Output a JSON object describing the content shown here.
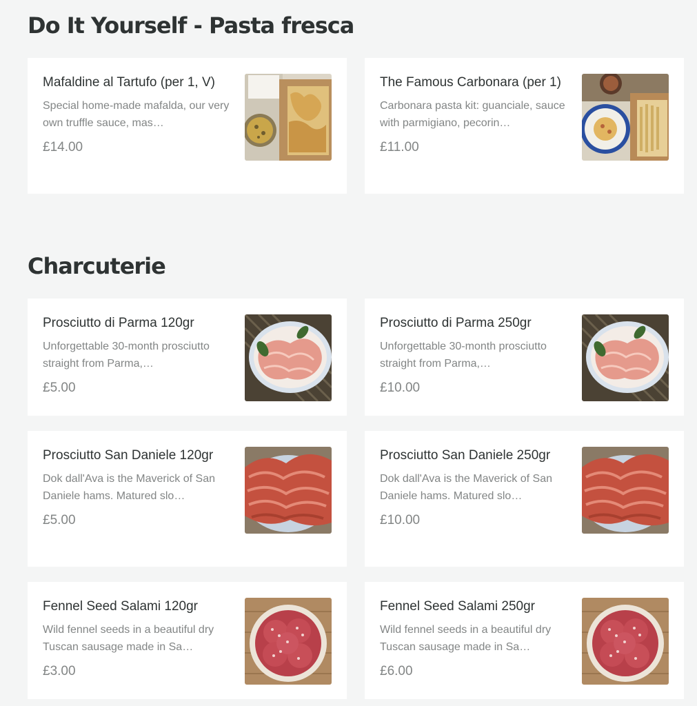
{
  "sections": [
    {
      "title": "Do It Yourself - Pasta fresca",
      "items": [
        {
          "name": "Mafaldine al Tartufo (per 1, V)",
          "description": "Special home-made mafalda, our very own truffle sauce, mas…",
          "price": "£14.00",
          "image": "pasta-kit-truffle-image"
        },
        {
          "name": "The Famous Carbonara (per 1)",
          "description": "Carbonara pasta kit: guanciale, sauce with parmigiano, pecorin…",
          "price": "£11.00",
          "image": "pasta-kit-carbonara-image"
        }
      ]
    },
    {
      "title": "Charcuterie",
      "items": [
        {
          "name": "Prosciutto di Parma 120gr",
          "description": "Unforgettable 30-month prosciutto straight from Parma,…",
          "price": "£5.00",
          "image": "prosciutto-plate-image"
        },
        {
          "name": "Prosciutto di Parma 250gr",
          "description": "Unforgettable 30-month prosciutto straight from Parma,…",
          "price": "£10.00",
          "image": "prosciutto-plate-image"
        },
        {
          "name": "Prosciutto San Daniele 120gr",
          "description": "Dok dall'Ava is the Maverick of San Daniele hams. Matured slo…",
          "price": "£5.00",
          "image": "san-daniele-ham-image"
        },
        {
          "name": "Prosciutto San Daniele 250gr",
          "description": "Dok dall'Ava is the Maverick of San Daniele hams. Matured slo…",
          "price": "£10.00",
          "image": "san-daniele-ham-image"
        },
        {
          "name": "Fennel Seed Salami 120gr",
          "description": "Wild fennel seeds in a beautiful dry Tuscan sausage made in Sa…",
          "price": "£3.00",
          "image": "salami-plate-image"
        },
        {
          "name": "Fennel Seed Salami 250gr",
          "description": "Wild fennel seeds in a beautiful dry Tuscan sausage made in Sa…",
          "price": "£6.00",
          "image": "salami-plate-image"
        }
      ]
    }
  ]
}
